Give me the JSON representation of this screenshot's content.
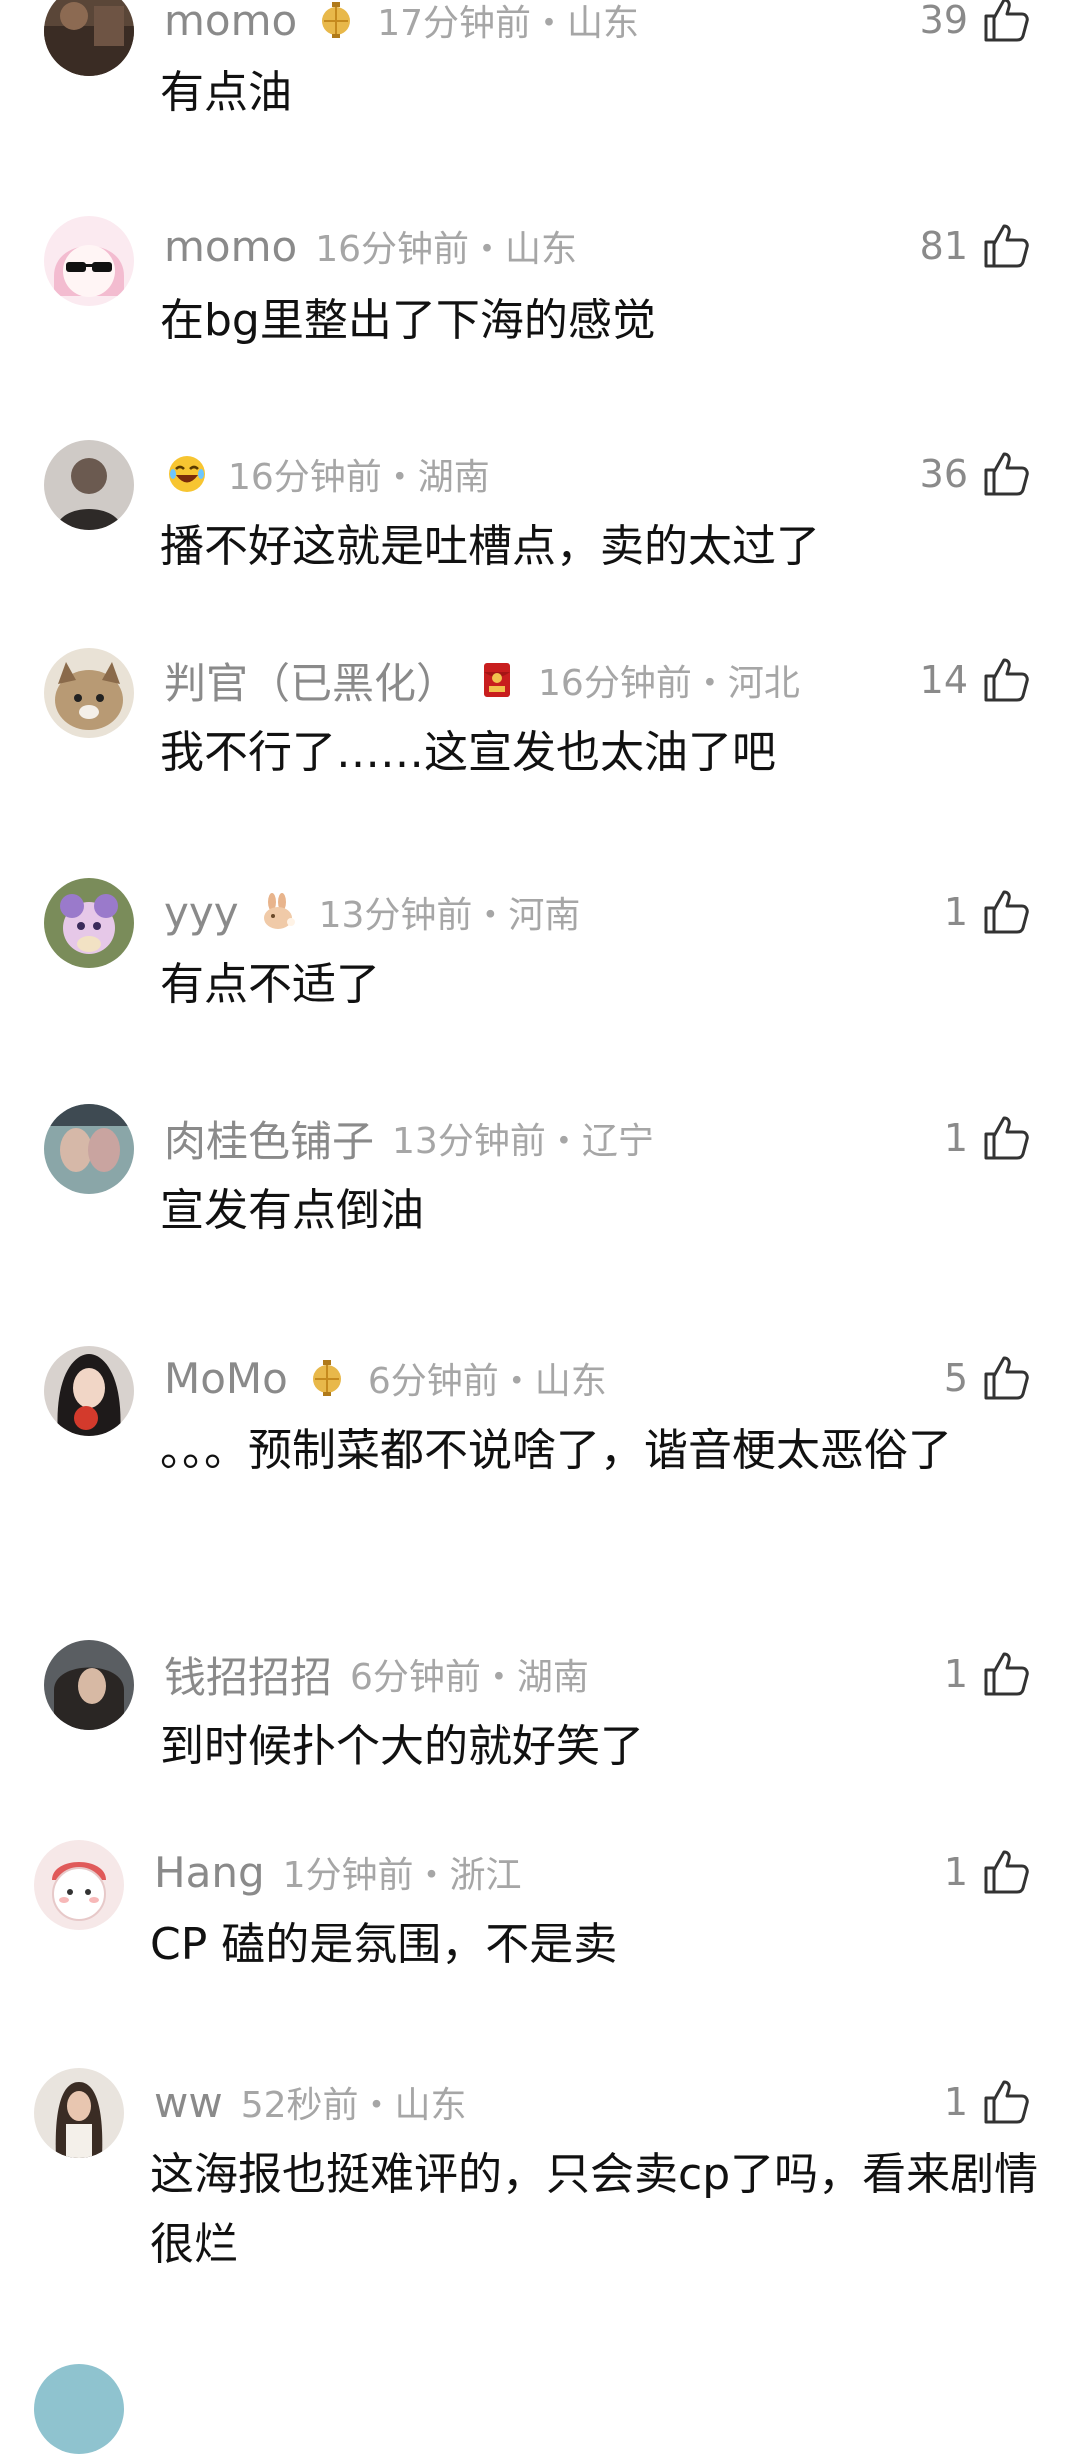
{
  "comments": [
    {
      "username": "momo",
      "badge": "lantern-badge",
      "time": "17分钟前・山东",
      "likes": "39",
      "text": "有点油"
    },
    {
      "username": "momo",
      "badge": "",
      "time": "16分钟前・山东",
      "likes": "81",
      "text": "在bg里整出了下海的感觉"
    },
    {
      "username": "",
      "badge": "laughing-emoji",
      "time": "16分钟前・湖南",
      "likes": "36",
      "text": "播不好这就是吐槽点，卖的太过了"
    },
    {
      "username": "判官（已黑化）",
      "badge": "red-envelope-badge",
      "time": "16分钟前・河北",
      "likes": "14",
      "text": "我不行了……这宣发也太油了吧"
    },
    {
      "username": "yyy",
      "badge": "rabbit-badge",
      "time": "13分钟前・河南",
      "likes": "1",
      "text": "有点不适了"
    },
    {
      "username": "肉桂色铺子",
      "badge": "",
      "time": "13分钟前・辽宁",
      "likes": "1",
      "text": "宣发有点倒油"
    },
    {
      "username": "MoMo",
      "badge": "lantern-badge",
      "time": "6分钟前・山东",
      "likes": "5",
      "text": "。。。预制菜都不说啥了，谐音梗太恶俗了"
    },
    {
      "username": "钱招招招",
      "badge": "",
      "time": "6分钟前・湖南",
      "likes": "1",
      "text": "到时候扑个大的就好笑了"
    },
    {
      "username": "Hang",
      "badge": "",
      "time": "1分钟前・浙江",
      "likes": "1",
      "text": "CP 磕的是氛围，不是卖"
    },
    {
      "username": "ww",
      "badge": "",
      "time": "52秒前・山东",
      "likes": "1",
      "text": "这海报也挺难评的，只会卖cp了吗，看来剧情很烂"
    }
  ],
  "colors": {
    "username": "#8a8a8a",
    "meta": "#a6a6a6",
    "text": "#111111",
    "background": "#ffffff"
  },
  "icons": {
    "like": "thumbs-up-outline-icon"
  }
}
